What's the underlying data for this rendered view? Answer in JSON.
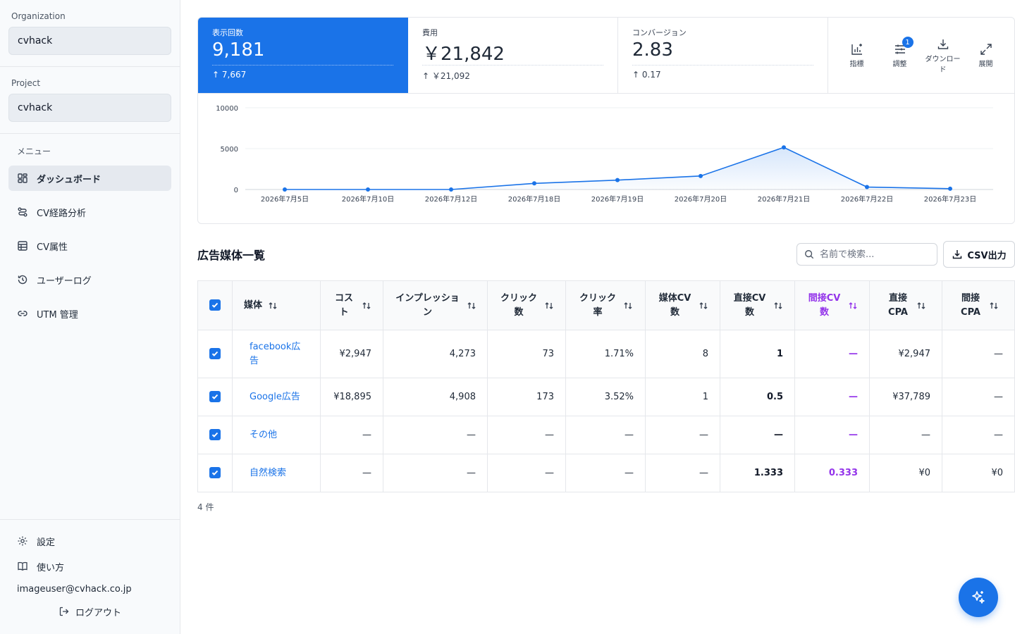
{
  "sidebar": {
    "organization_label": "Organization",
    "organization_value": "cvhack",
    "project_label": "Project",
    "project_value": "cvhack",
    "menu_title": "メニュー",
    "items": [
      {
        "label": "ダッシュボード",
        "icon": "dashboard-icon"
      },
      {
        "label": "CV経路分析",
        "icon": "route-icon"
      },
      {
        "label": "CV属性",
        "icon": "table-icon"
      },
      {
        "label": "ユーザーログ",
        "icon": "history-icon"
      },
      {
        "label": "UTM 管理",
        "icon": "link-icon"
      }
    ],
    "settings_label": "設定",
    "help_label": "使い方",
    "email": "imageuser@cvhack.co.jp",
    "logout_label": "ログアウト"
  },
  "metrics": [
    {
      "label": "表示回数",
      "value": "9,181",
      "delta": "↑ 7,667"
    },
    {
      "label": "費用",
      "value": "￥21,842",
      "delta": "↑ ￥21,092"
    },
    {
      "label": "コンバージョン",
      "value": "2.83",
      "delta": "↑ 0.17"
    }
  ],
  "tools": {
    "metrics_label": "指標",
    "adjust_label": "調整",
    "adjust_badge": "1",
    "download_label": "ダウンロード",
    "expand_label": "展開"
  },
  "chart_data": {
    "type": "area",
    "x": [
      "2026年7月5日",
      "2026年7月10日",
      "2026年7月12日",
      "2026年7月18日",
      "2026年7月19日",
      "2026年7月20日",
      "2026年7月21日",
      "2026年7月22日",
      "2026年7月23日"
    ],
    "series": [
      {
        "values": [
          0,
          0,
          0,
          750,
          1150,
          1650,
          5150,
          300,
          100
        ]
      }
    ],
    "yticks": [
      "0",
      "5000",
      "10000"
    ],
    "ylim": [
      0,
      10000
    ],
    "grid": true,
    "color": "#1a73e8"
  },
  "table_section": {
    "title": "広告媒体一覧",
    "search_placeholder": "名前で検索...",
    "csv_label": "CSV出力",
    "columns": [
      "媒体",
      "コスト",
      "インプレッション",
      "クリック数",
      "クリック率",
      "媒体CV数",
      "直接CV数",
      "間接CV数",
      "直接CPA",
      "間接CPA"
    ],
    "rows": [
      {
        "media": "facebook広告",
        "cells": [
          "¥2,947",
          "4,273",
          "73",
          "1.71%",
          "8",
          "1",
          "—",
          "¥2,947",
          "—"
        ]
      },
      {
        "media": "Google広告",
        "cells": [
          "¥18,895",
          "4,908",
          "173",
          "3.52%",
          "1",
          "0.5",
          "—",
          "¥37,789",
          "—"
        ]
      },
      {
        "media": "その他",
        "cells": [
          "—",
          "—",
          "—",
          "—",
          "—",
          "—",
          "—",
          "—",
          "—"
        ]
      },
      {
        "media": "自然検索",
        "cells": [
          "—",
          "—",
          "—",
          "—",
          "—",
          "1.333",
          "0.333",
          "¥0",
          "¥0"
        ]
      }
    ],
    "count_label": "4 件"
  },
  "colors": {
    "accent": "#1a73e8",
    "indirect": "#9333ea"
  }
}
